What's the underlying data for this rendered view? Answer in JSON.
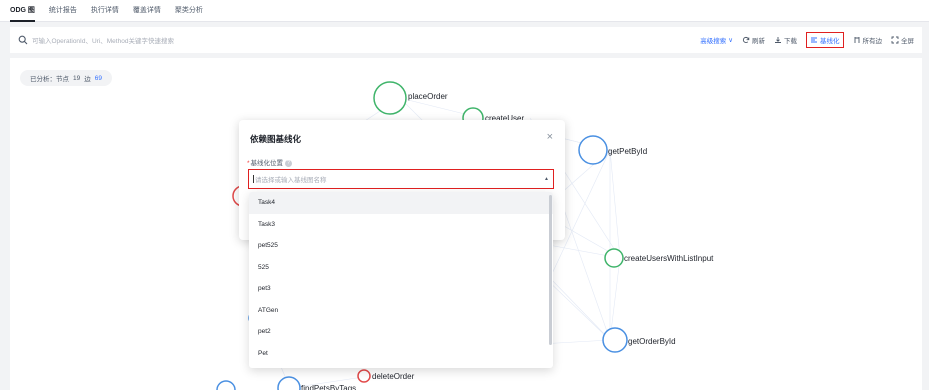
{
  "tabs": [
    {
      "label": "ODG 图",
      "active": true
    },
    {
      "label": "统计报告",
      "active": false
    },
    {
      "label": "执行详情",
      "active": false
    },
    {
      "label": "覆盖详情",
      "active": false
    },
    {
      "label": "聚类分析",
      "active": false
    }
  ],
  "search": {
    "placeholder": "可输入OperationId、Uri、Method关键字快速搜索"
  },
  "tools": {
    "advanced_search": "高级搜索",
    "advanced_search_caret": "∨",
    "refresh": "刷新",
    "download": "下载",
    "baseline": "基线化",
    "all_edges": "所有边",
    "fullscreen": "全屏"
  },
  "stats": {
    "prefix": "已分析：节点",
    "nodes": "19",
    "edge_label": "边",
    "edges": "69"
  },
  "graph_nodes": [
    {
      "label": "placeOrder",
      "color": "#3fb46a"
    },
    {
      "label": "createUser",
      "color": "#3fb46a"
    },
    {
      "label": "getPetById",
      "color": "#4a90e2"
    },
    {
      "label": "createUsersWithListInput",
      "color": "#3fb46a"
    },
    {
      "label": "getOrderById",
      "color": "#4a90e2"
    },
    {
      "label": "deleteOrder",
      "color": "#e24a4a"
    },
    {
      "label": "findPetsByTags",
      "color": "#4a90e2"
    }
  ],
  "modal": {
    "title": "依赖图基线化",
    "close": "×",
    "field_label": "基线化位置",
    "required_mark": "*",
    "help_mark": "?",
    "select_placeholder": "请选择或输入基线图名称",
    "caret": "▲"
  },
  "dropdown_options": [
    "Task4",
    "Task3",
    "pet525",
    "525",
    "pet3",
    "ATGen",
    "pet2",
    "Pet"
  ],
  "colors": {
    "accent": "#3370ff",
    "highlight_border": "#e02020",
    "green_node": "#3fb46a",
    "blue_node": "#4a90e2",
    "red_node": "#e24a4a",
    "orange_node": "#f5a623"
  }
}
